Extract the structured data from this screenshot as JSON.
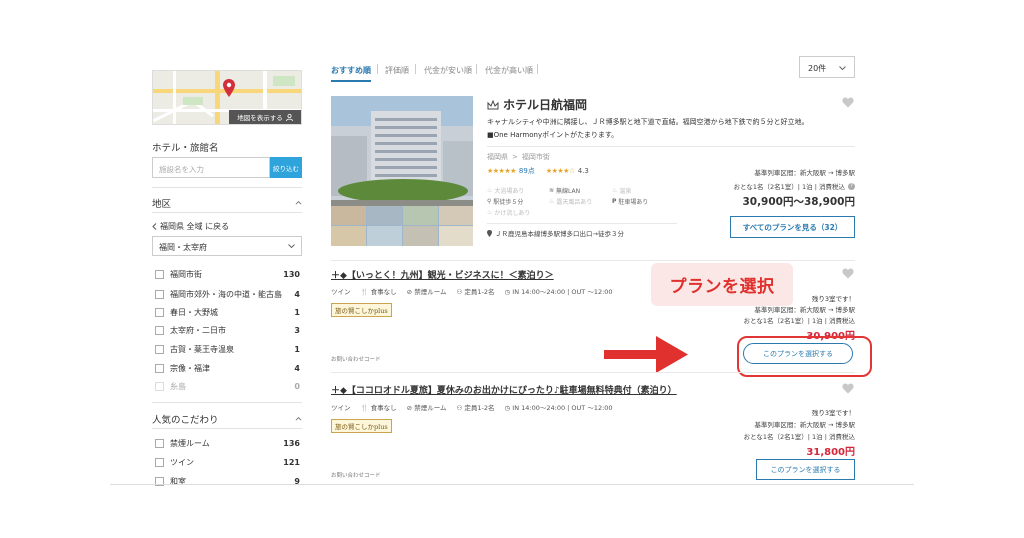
{
  "sidebar": {
    "map_button": "地図を表示する",
    "hotel_name_heading": "ホテル・旅館名",
    "search_placeholder": "施設名を入力",
    "search_button": "絞り込む",
    "area_heading": "地区",
    "back_link": "福岡県 全域 に戻る",
    "area_select_value": "福岡・太宰府",
    "areas": [
      {
        "label": "福岡市街",
        "count": "130"
      },
      {
        "label": "福岡市郊外・海の中道・能古島",
        "count": "4"
      },
      {
        "label": "春日・大野城",
        "count": "1"
      },
      {
        "label": "太宰府・二日市",
        "count": "3"
      },
      {
        "label": "古賀・薬王寺温泉",
        "count": "1"
      },
      {
        "label": "宗像・福津",
        "count": "4"
      },
      {
        "label": "糸島",
        "count": "0"
      }
    ],
    "popular_heading": "人気のこだわり",
    "popular": [
      {
        "label": "禁煙ルーム",
        "count": "136"
      },
      {
        "label": "ツイン",
        "count": "121"
      },
      {
        "label": "和室",
        "count": "9"
      }
    ]
  },
  "sort_tabs": [
    "おすすめ順",
    "評価順",
    "代金が安い順",
    "代金が高い順"
  ],
  "per_page": "20件",
  "hotel": {
    "name": "ホテル日航福岡",
    "description": "キャナルシティや中洲に隣接し、ＪＲ博多駅と地下道で直結。福岡空港から地下鉄で約５分と好立地。",
    "description2": "■One Harmonyポイントがたまります。",
    "breadcrumb_pref": "福岡県",
    "breadcrumb_area": "福岡市街",
    "rating_score": "89点",
    "star_rating": "4.3",
    "amenities": [
      {
        "label": "大浴場あり",
        "on": false
      },
      {
        "label": "無線LAN",
        "on": true
      },
      {
        "label": "温泉",
        "on": false
      },
      {
        "label": "駅徒歩５分",
        "on": true
      },
      {
        "label": "露天風呂あり",
        "on": false
      },
      {
        "label": "駐車場あり",
        "on": true
      },
      {
        "label": "かけ流しあり",
        "on": false
      }
    ],
    "access": "ＪＲ鹿児島本線博多駅博多口出口→徒歩３分",
    "price_route": "基準列車区間：新大阪駅 → 博多駅",
    "price_unit": "おとな1名（2名1室）| 1泊 | 消費税込",
    "price_range": "30,900円〜38,900円",
    "all_plans_button": "すべてのプランを見る（32）"
  },
  "plans": [
    {
      "title": "＋◆【いっとく！九州】観光・ビジネスに！＜素泊り＞",
      "room": "ツイン",
      "meal": "食事なし",
      "smoking": "禁煙ルーム",
      "capacity": "定員1-2名",
      "inout": "IN 14:00〜24:00 | OUT 〜12:00",
      "badge": "旅の賢こしかplus",
      "inquiry": "お問い合わせコード",
      "remaining": "残り3室です！",
      "route": "基準列車区間：新大阪駅 → 博多駅",
      "unit": "おとな1名（2名1室）| 1泊 | 消費税込",
      "price": "30,900円",
      "button": "このプランを選択する"
    },
    {
      "title": "＋◆【ココロオドル夏旅】夏休みのお出かけにぴったり♪駐車場無料特典付（素泊り）",
      "room": "ツイン",
      "meal": "食事なし",
      "smoking": "禁煙ルーム",
      "capacity": "定員1-2名",
      "inout": "IN 14:00〜24:00 | OUT 〜12:00",
      "badge": "旅の賢こしかplus",
      "inquiry": "お問い合わせコード",
      "remaining": "残り3室です！",
      "route": "基準列車区間：新大阪駅 → 博多駅",
      "unit": "おとな1名（2名1室）| 1泊 | 消費税込",
      "price": "31,800円",
      "button": "このプランを選択する"
    }
  ],
  "callout": "プランを選択",
  "colors": {
    "accent": "#2a7ab0",
    "highlight": "#e23636",
    "price": "#d4263b"
  }
}
